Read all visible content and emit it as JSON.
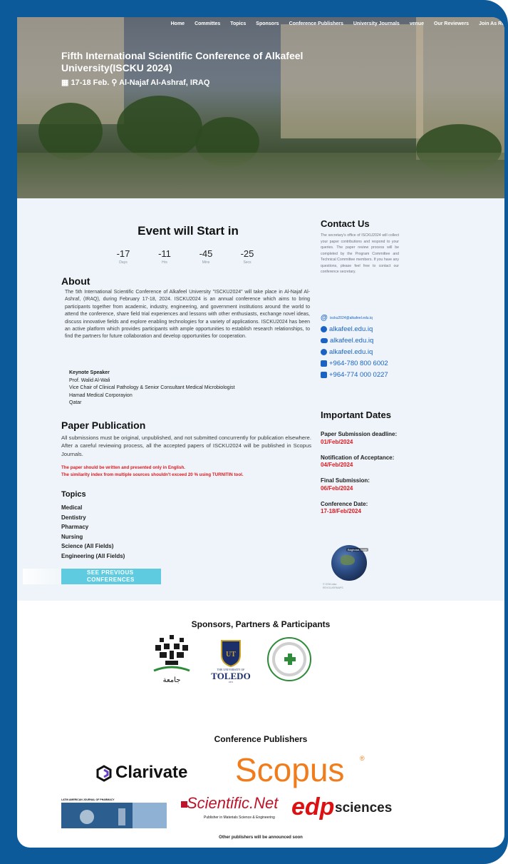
{
  "nav": [
    "Home",
    "Committes",
    "Topics",
    "Sponsors",
    "Conference Publishers",
    "University Journals",
    "venue",
    "Our Reviewers",
    "Join As Re"
  ],
  "hero": {
    "title": "Fifth International Scientific Conference of Alkafeel University(ISCKU 2024)",
    "date": "17-18 Feb.",
    "location": "Al-Najaf Al-Ashraf, IRAQ"
  },
  "countdown": {
    "title": "Event will Start in",
    "items": [
      {
        "value": "-17",
        "label": "Days"
      },
      {
        "value": "-11",
        "label": "Hrs"
      },
      {
        "value": "-45",
        "label": "Mins"
      },
      {
        "value": "-25",
        "label": "Secs"
      }
    ]
  },
  "about": {
    "heading": "About",
    "text": "The 5th International Scientific Conference of Alkafeel University \"ISCKU2024\" will take place in Al-Najaf Al-Ashraf, (IRAQ), during February 17-18, 2024. ISCKU2024 is an annual conference which aims to bring participants together from academic, industry, engineering, and government institutions around the world to attend the conference, share field trial experiences and lessons with other enthusiasts, exchange novel ideas, discuss innovative fields and explore enabling technologies for a variety of applications. ISCKU2024 has been an active platform which provides participants with ample opportunities to establish research relationships, to find the partners for future collaboration and develop opportunities for cooperation."
  },
  "keynote": {
    "heading": "Keynote Speaker",
    "name": "Prof. Walid Al-Wali",
    "role": "Vice Chair of Clinical Pathology & Senior Consultant Medical Microbiologist",
    "org": "Hamad Medical Corporayion",
    "country": "Qatar"
  },
  "publication": {
    "heading": "Paper Publication",
    "text": "All submissions must be original, unpublished, and not submitted concurrently for publication elsewhere. After a careful reviewing process, all the accepted papers of ISCKU2024 will be published in Scopus Journals.",
    "warning1": "The paper should be written and presented only in English.",
    "warning2": "The similarity index from multiple sources shouldn't exceed 20 % using TURNITIN tool."
  },
  "topics": {
    "heading": "Topics",
    "items": [
      "Medical",
      "Dentistry",
      "Pharmacy",
      "Nursing",
      "Science (All Fields)",
      "Engineering (All Fields)"
    ]
  },
  "previous_button": "SEE PREVIOUS CONFERENCES",
  "contact": {
    "heading": "Contact Us",
    "text": "The secretary's office of ISCKU2024 will collect your paper contributions and respond to your queries. The paper review process will be completed by the Program Committee and Technical Committee members. If you have any questions, please feel free to contact our conference secretary.",
    "email": "iscku2024@alkafeel.edu.iq",
    "facebook": "alkafeel.edu.iq",
    "youtube": "alkafeel.edu.iq",
    "telegram": "alkafeel.edu.iq",
    "phone1": "+964-780 800 6002",
    "phone2": "+964-774 000 0227"
  },
  "dates": {
    "heading": "Important Dates",
    "items": [
      {
        "label": "Paper Submission deadline:",
        "value": "01/Feb/2024"
      },
      {
        "label": "Notification of Acceptance:",
        "value": "04/Feb/2024"
      },
      {
        "label": "Final Submission:",
        "value": "06/Feb/2024"
      },
      {
        "label": "Conference Date:",
        "value": "17-18/Feb/2024"
      }
    ]
  },
  "map": {
    "tag": "Baghdad, Iraqk",
    "caption": "© OSM data\nREVOLVERMAPS"
  },
  "sponsors": {
    "heading": "Sponsors, Partners & Participants",
    "toledo_line1": "THE UNIVERSITY OF",
    "toledo_line2": "TOLEDO",
    "toledo_year": "1872"
  },
  "publishers": {
    "heading": "Conference Publishers",
    "clarivate": "Clarivate",
    "scopus": "Scopus",
    "lajp": "LATIN AMERICAN JOURNAL OF PHARMACY",
    "scinet": "Scientific.Net",
    "scinet_sub": "Publisher in Materials Science & Engineering",
    "edp": "edp",
    "edp_sciences": "sciences",
    "note": "Other publishers will be announced soon"
  }
}
